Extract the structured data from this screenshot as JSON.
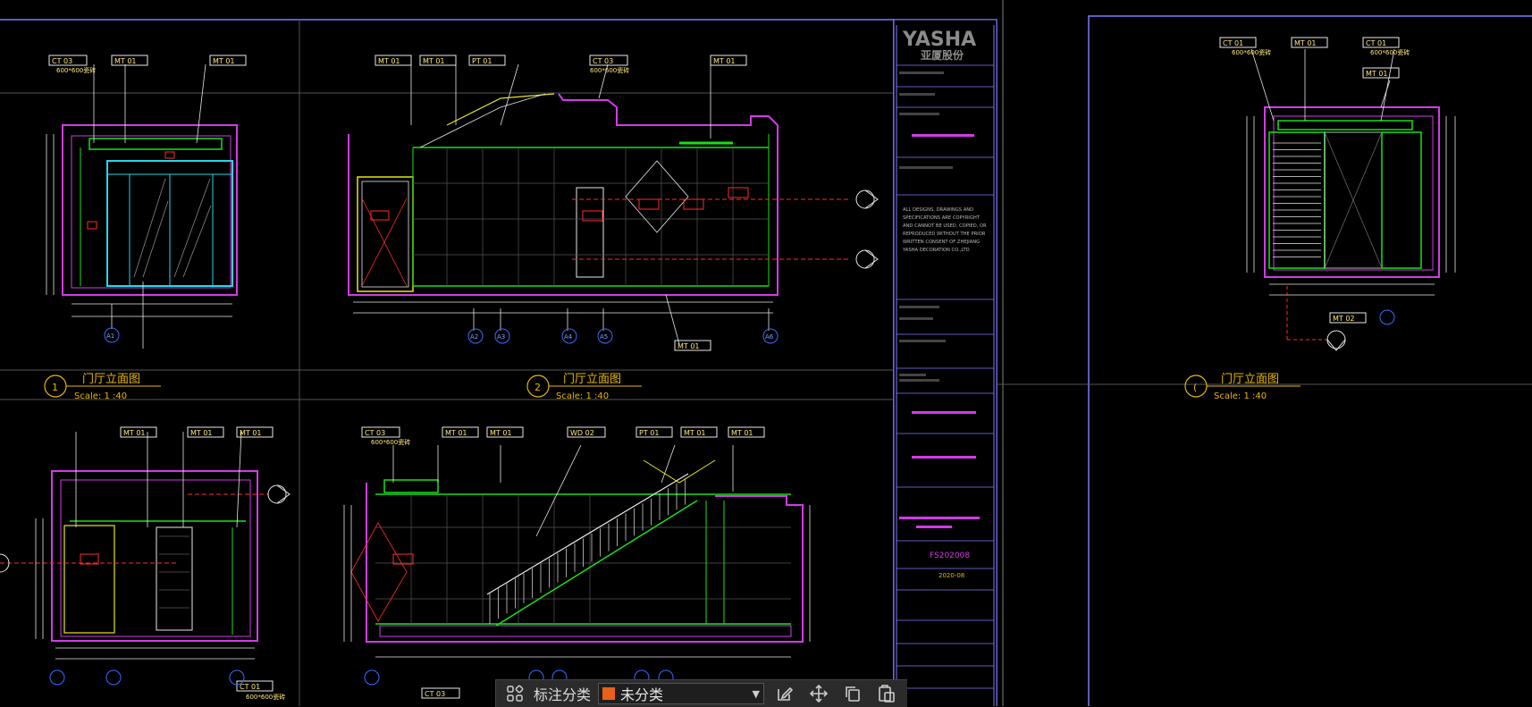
{
  "drawing": {
    "views": [
      {
        "num": "1",
        "title": "门厅立面图",
        "scale": "Scale: 1 :40"
      },
      {
        "num": "2",
        "title": "门厅立面图",
        "scale": "Scale: 1 :40"
      },
      {
        "num": "(",
        "title": "门厅立面图",
        "scale": "Scale: 1 :40"
      }
    ],
    "tags": {
      "ct03": "CT 03",
      "mt01": "MT 01",
      "pt01": "PT 01",
      "ct01": "CT 01",
      "wd02": "WD 02",
      "mt02": "MT 02",
      "size600": "600*600瓷砖"
    },
    "axis_labels": [
      "A1",
      "A2",
      "A3",
      "A4",
      "A5",
      "A6"
    ],
    "title_block": {
      "brand": "YASHA",
      "brand_cn": "亚厦股份",
      "project_number": "FS202008",
      "date": "2020-08",
      "note_lines": [
        "ALL DESIGNS, DRAWINGS AND",
        "SPECIFICATIONS ARE COPYRIGHT",
        "AND CANNOT BE USED, COPIED, OR",
        "REPRODUCED WITHOUT THE PRIOR",
        "WRITTEN CONSENT OF ZHEJIANG",
        "YASHA DECORATION CO.,LTD"
      ]
    }
  },
  "toolbar": {
    "label": "标注分类",
    "selected": "未分类"
  },
  "colors": {
    "magenta": "#d23be6",
    "green": "#19e019",
    "cyan": "#27d6e6",
    "yellow": "#e6e619",
    "red": "#ff2a2a",
    "white": "#e8e8e8",
    "blue": "#3a6bff",
    "tag": "#ffe87a"
  }
}
